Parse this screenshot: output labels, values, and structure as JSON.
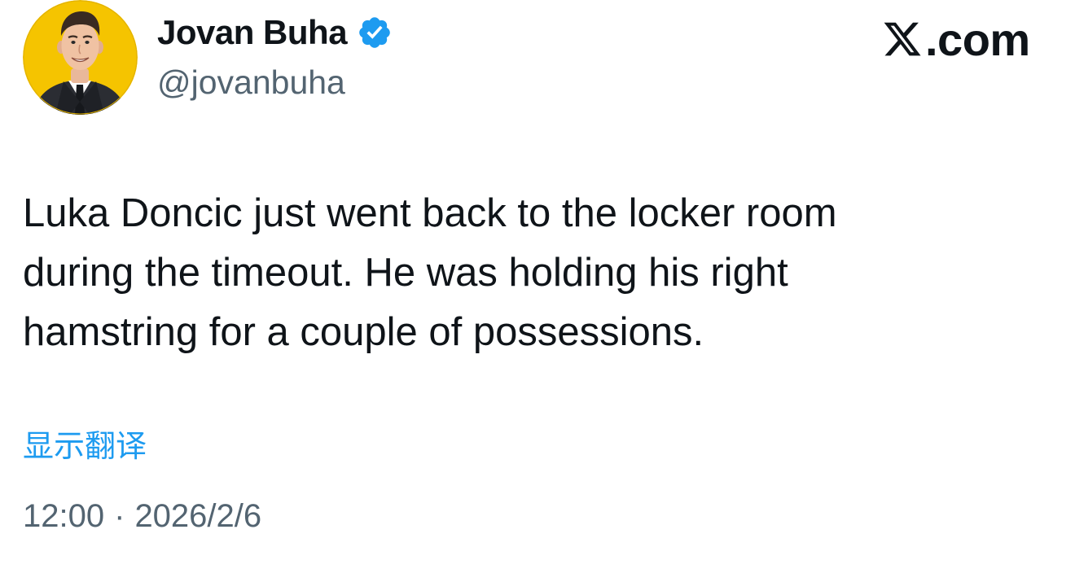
{
  "author": {
    "name": "Jovan Buha",
    "handle": "@jovanbuha",
    "verified": true,
    "avatar_icon": "cartoon-avatar-icon",
    "avatar_bg": "#f5c400"
  },
  "brand": {
    "label": ".com",
    "icon": "x-logo-icon"
  },
  "tweet": {
    "line1": "Luka Doncic just went back to the locker room",
    "line2": "during the timeout. He was holding his right",
    "line3": "hamstring for a couple of possessions."
  },
  "translate_label": "显示翻译",
  "meta": {
    "time": "12:00",
    "separator": "·",
    "date": "2026/2/6"
  },
  "colors": {
    "accent": "#1d9bf0",
    "text": "#0f1419",
    "secondary": "#536471"
  }
}
